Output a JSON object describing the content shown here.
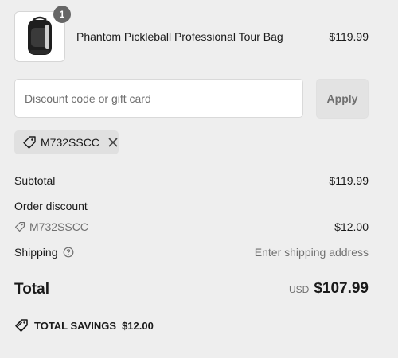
{
  "product": {
    "name": "Phantom Pickleball Professional Tour Bag",
    "price": "$119.99",
    "quantity": "1",
    "image_icon": "backpack-image"
  },
  "discount": {
    "placeholder": "Discount code or gift card",
    "apply_label": "Apply",
    "applied_code": "M732SSCC"
  },
  "summary": {
    "subtotal_label": "Subtotal",
    "subtotal_value": "$119.99",
    "order_discount_label": "Order discount",
    "discount_code": "M732SSCC",
    "discount_value": "– $12.00",
    "shipping_label": "Shipping",
    "shipping_value": "Enter shipping address",
    "total_label": "Total",
    "currency": "USD",
    "total_value": "$107.99",
    "savings_label": "TOTAL SAVINGS",
    "savings_value": "$12.00"
  },
  "colors": {
    "background": "#eeeeee",
    "badge": "#666666",
    "muted_text": "#707070"
  }
}
